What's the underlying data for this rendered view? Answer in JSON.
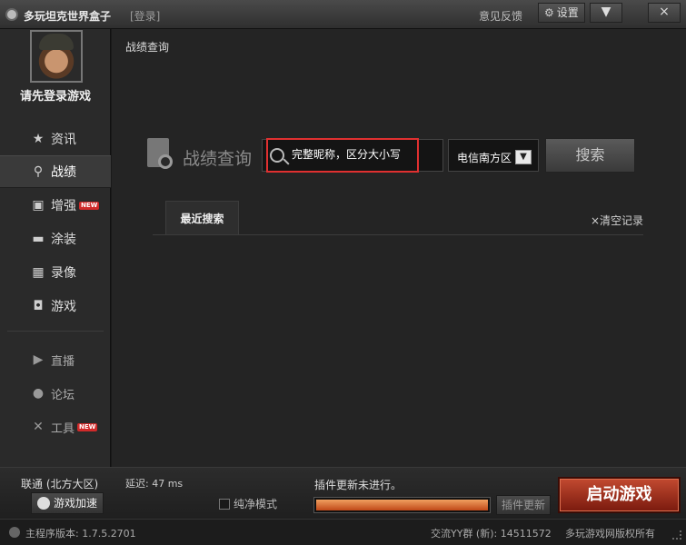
{
  "titlebar": {
    "app_title": "多玩坦克世界盒子",
    "login_link": "[登录]",
    "feedback": "意见反馈",
    "settings": "设置",
    "minimize": "▼",
    "close": "×"
  },
  "sidebar": {
    "login_prompt": "请先登录游戏",
    "items": [
      {
        "label": "资讯",
        "icon": "star-icon"
      },
      {
        "label": "战绩",
        "icon": "search-icon"
      },
      {
        "label": "增强",
        "icon": "toolbox-icon",
        "badge": "NEW"
      },
      {
        "label": "涂装",
        "icon": "tank-icon"
      },
      {
        "label": "录像",
        "icon": "film-icon"
      },
      {
        "label": "游戏",
        "icon": "gamepad-icon"
      },
      {
        "label": "直播",
        "icon": "play-icon"
      },
      {
        "label": "论坛",
        "icon": "chat-icon"
      },
      {
        "label": "工具",
        "icon": "tools-icon",
        "badge": "NEW"
      }
    ]
  },
  "content": {
    "breadcrumb": "战绩查询",
    "heading": "战绩查询",
    "search": {
      "placeholder": "完整昵称，区分大小写",
      "value": ""
    },
    "region": {
      "selected": "电信南方区"
    },
    "search_button": "搜索",
    "tab_recent": "最近搜索",
    "clear_history": "×清空记录"
  },
  "footer": {
    "network": "联通 (北方大区)",
    "latency": "延迟: 47 ms",
    "accel_button": "游戏加速",
    "pure_mode": "纯净模式",
    "update_status": "插件更新未进行。",
    "progress": 1.0,
    "update_button": "插件更新",
    "launch_button": "启动游戏"
  },
  "statusbar": {
    "version": "主程序版本: 1.7.5.2701",
    "qq_group": "交流YY群 (新): 14511572",
    "copyright": "多玩游戏网版权所有"
  },
  "colors": {
    "accent_red": "#e03030",
    "launch_button": "#b03a24",
    "progress_fill": "#e07a3a"
  }
}
